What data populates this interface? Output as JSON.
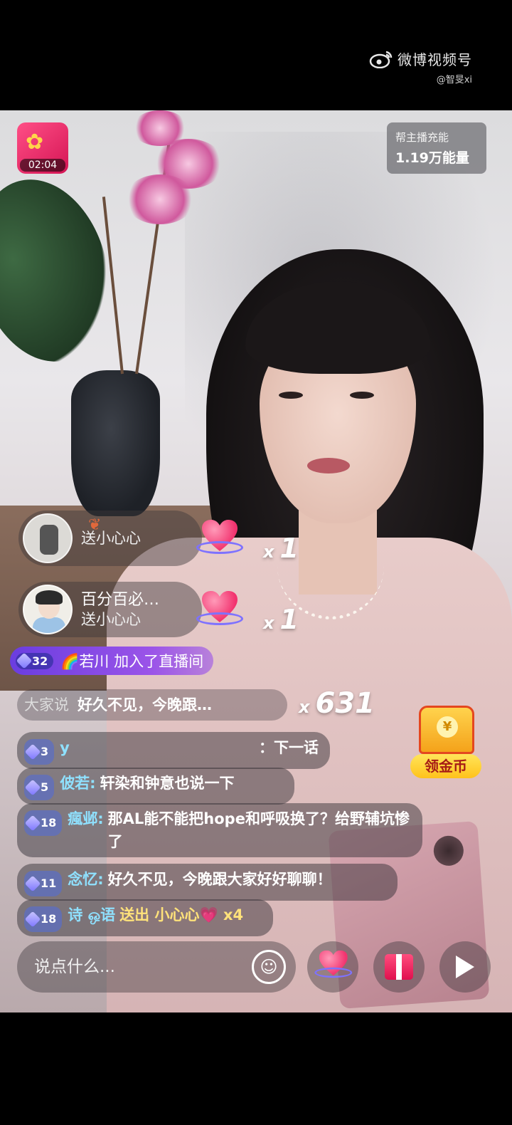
{
  "watermark": {
    "brand": "微博视频号",
    "user": "@智旻xi"
  },
  "stream": {
    "timer": "02:04",
    "charge_label": "帮主播充能",
    "charge_value": "1.19万能量"
  },
  "gift_events": [
    {
      "name": "",
      "action": "送小心心",
      "combo_x": "x",
      "combo_count": "1"
    },
    {
      "name": "百分百必…",
      "action": "送小心心",
      "combo_x": "x",
      "combo_count": "1"
    }
  ],
  "join": {
    "level": "32",
    "text": "🌈若川 加入了直播间"
  },
  "say_row": {
    "label": "大家说",
    "message": "好久不见，今晚跟…",
    "combo_x": "x",
    "combo_count": "631"
  },
  "chat": [
    {
      "level": "3",
      "user": "y",
      "message": "：下一话"
    },
    {
      "level": "5",
      "user": "佊若:",
      "message": "轩染和钟意也说一下"
    },
    {
      "level": "18",
      "user": "瘋邺:",
      "message": "那AL能不能把hope和呼吸换了？给野辅坑惨了"
    },
    {
      "level": "11",
      "user": "念忆:",
      "message": "好久不见，今晚跟大家好好聊聊！"
    },
    {
      "level": "18",
      "user": "诗 ஒ语",
      "message": "送出 小心心💗 x4"
    }
  ],
  "coin": {
    "label": "领金币"
  },
  "input": {
    "placeholder": "说点什么..."
  },
  "icons": {
    "emoji": "emoji-icon",
    "heart": "heart-icon",
    "gift": "gift-icon",
    "share": "share-icon"
  },
  "colors": {
    "accent_purple": "#7d4fe6",
    "chat_user": "#8fe1ff",
    "coin_yellow": "#ffc21b"
  }
}
